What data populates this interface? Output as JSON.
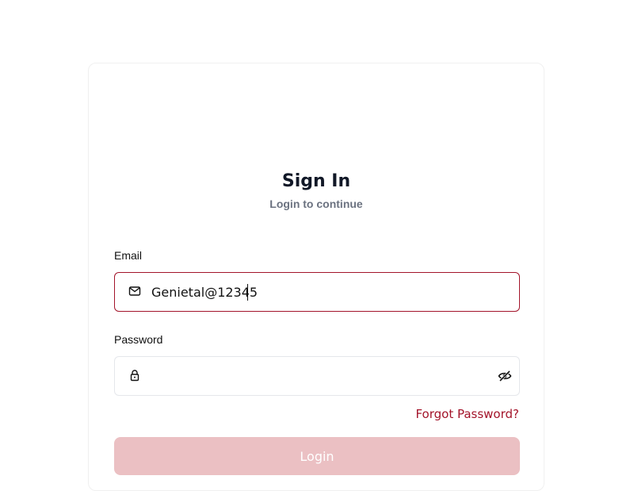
{
  "signin": {
    "title": "Sign In",
    "subtitle": "Login to continue"
  },
  "email": {
    "label": "Email",
    "value": "Genietal@12345",
    "icon": "mail-icon"
  },
  "password": {
    "label": "Password",
    "value": "",
    "icon": "lock-icon",
    "toggle_icon": "eye-off-icon"
  },
  "forgot_password": "Forgot Password?",
  "login_button": "Login",
  "colors": {
    "accent": "#a3142a",
    "login_disabled": "#ebc0c3",
    "subtitle": "#6b7280",
    "title": "#111827"
  }
}
